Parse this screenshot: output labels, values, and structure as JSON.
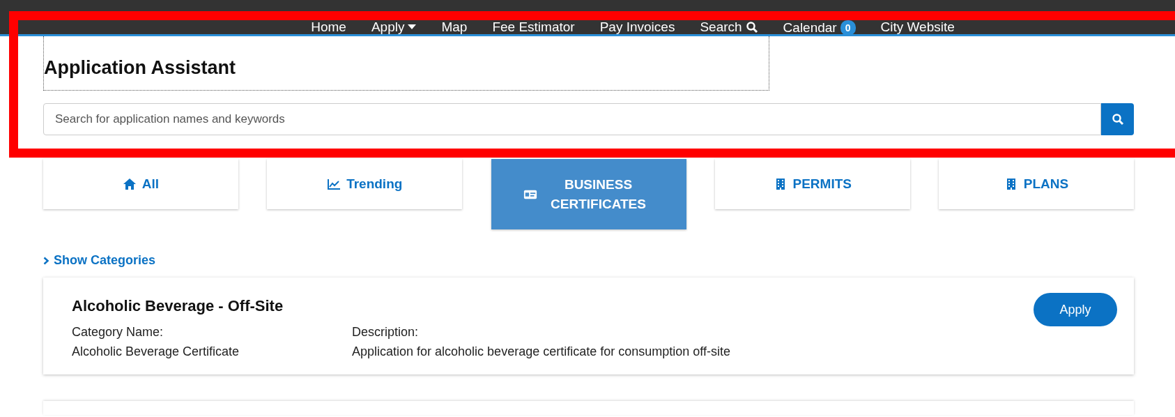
{
  "nav": {
    "items": [
      {
        "label": "Home",
        "kind": "link"
      },
      {
        "label": "Apply",
        "kind": "dropdown"
      },
      {
        "label": "Map",
        "kind": "link"
      },
      {
        "label": "Fee Estimator",
        "kind": "link"
      },
      {
        "label": "Pay Invoices",
        "kind": "link"
      },
      {
        "label": "Search",
        "kind": "search"
      },
      {
        "label": "Calendar",
        "kind": "badge",
        "badge": "0"
      },
      {
        "label": "City Website",
        "kind": "link"
      }
    ]
  },
  "heading": "Application Assistant",
  "search": {
    "placeholder": "Search for application names and keywords"
  },
  "tabs": [
    {
      "label": "All",
      "kind": "home",
      "selected": false
    },
    {
      "label": "Trending",
      "kind": "chart",
      "selected": false
    },
    {
      "label": "BUSINESS CERTIFICATES",
      "kind": "card",
      "selected": true
    },
    {
      "label": "PERMITS",
      "kind": "building",
      "selected": false
    },
    {
      "label": "PLANS",
      "kind": "building",
      "selected": false
    }
  ],
  "toggle": {
    "label": "Show Categories",
    "expanded": false
  },
  "results": [
    {
      "title": "Alcoholic Beverage - Off-Site",
      "fields": [
        {
          "label": "Category Name:",
          "value": "Alcoholic Beverage Certificate"
        },
        {
          "label": "Description:",
          "value": "Application for alcoholic beverage certificate for consumption off-site"
        }
      ],
      "action": "Apply"
    }
  ],
  "annotation": {
    "kind": "highlight-frame"
  }
}
